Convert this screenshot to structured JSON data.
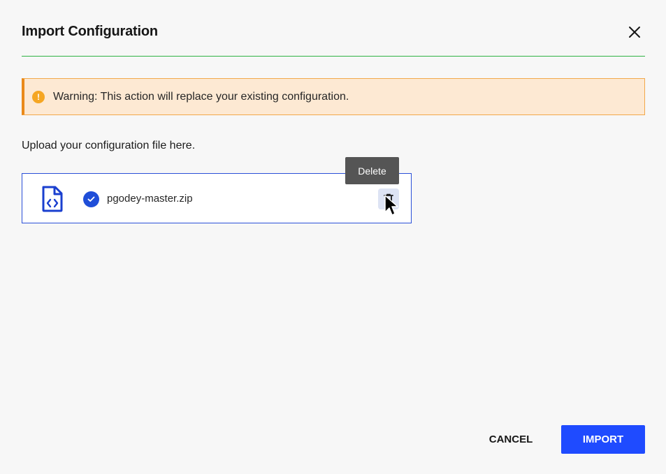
{
  "dialog": {
    "title": "Import Configuration",
    "close_icon": "close-icon"
  },
  "warning": {
    "icon": "!",
    "text": "Warning: This action will replace your existing configuration."
  },
  "upload": {
    "label": "Upload your configuration file here.",
    "file": {
      "name": "pgodey-master.zip",
      "file_icon": "code-file-icon",
      "status_icon": "check-circle-icon",
      "delete_icon": "trash-icon"
    },
    "tooltip": "Delete"
  },
  "footer": {
    "cancel_label": "CANCEL",
    "import_label": "IMPORT"
  },
  "colors": {
    "accent": "#1f4bff",
    "divider": "#2fb344",
    "warning_bg": "#fde9d3",
    "warning_border": "#ea8a1a"
  }
}
